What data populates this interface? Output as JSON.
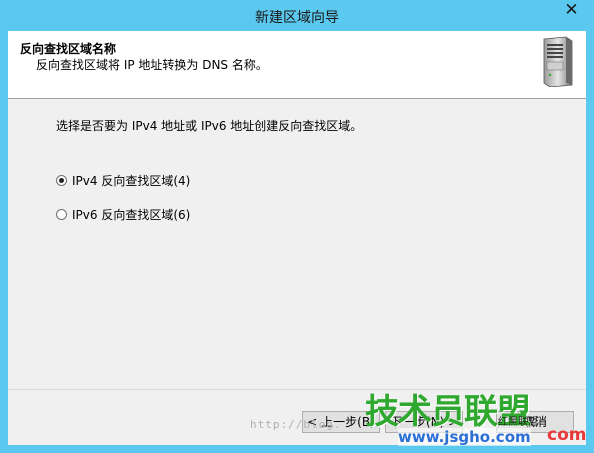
{
  "window": {
    "title": "新建区域向导",
    "close_glyph": "✕"
  },
  "header": {
    "title": "反向查找区域名称",
    "subtitle": "反向查找区域将 IP 地址转换为 DNS 名称。",
    "icon": "server-icon"
  },
  "main": {
    "prompt": "选择是否要为 IPv4 地址或 IPv6 地址创建反向查找区域。",
    "options": [
      {
        "label": "IPv4 反向查找区域(4)",
        "selected": true
      },
      {
        "label": "IPv6 反向查找区域(6)",
        "selected": false
      }
    ]
  },
  "buttons": {
    "back": "< 上一步(B)",
    "next": "下一步(N) >",
    "cancel": "取消"
  },
  "watermark": {
    "url": "http://blog.",
    "logo": "技术员联盟",
    "site": "www.jsgho.com",
    "red_text": "红黑联盟",
    "com": "com"
  },
  "colors": {
    "titlebar": "#5ac8ef",
    "client": "#f0f0f0"
  }
}
